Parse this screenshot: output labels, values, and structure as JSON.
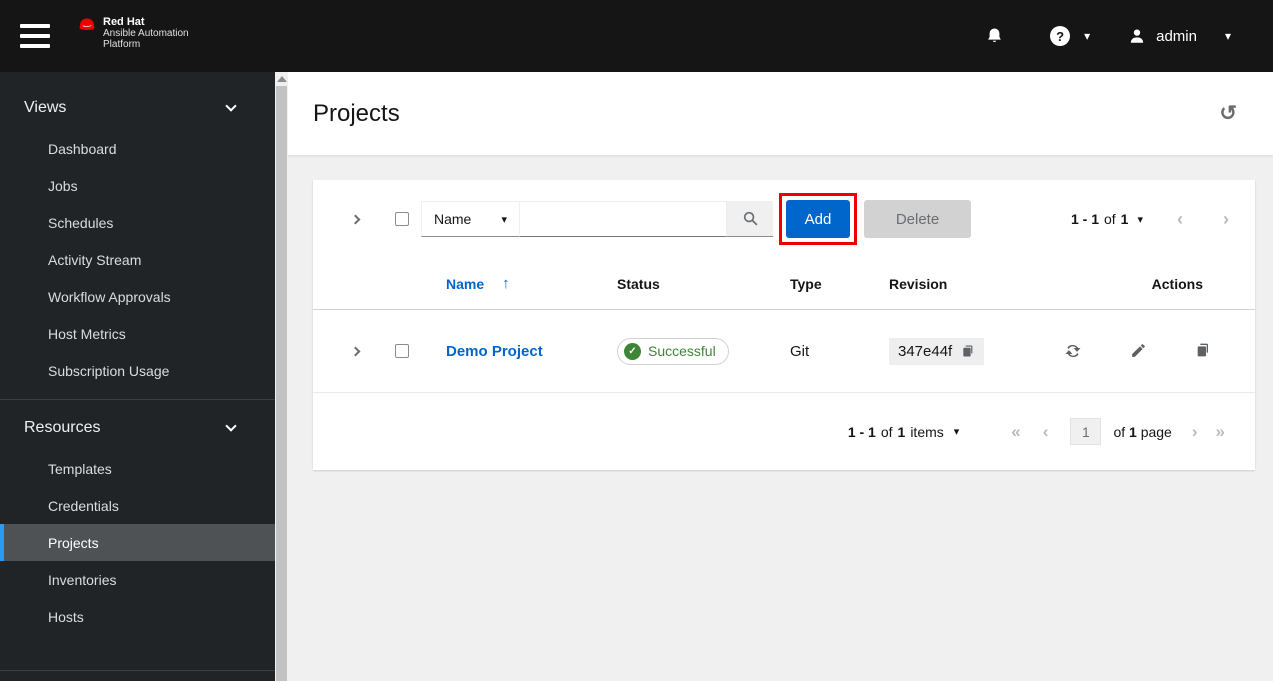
{
  "colors": {
    "primary_blue": "#0066cc",
    "annotation_red": "#ee0000",
    "success_green": "#3e8635",
    "nav_accent_blue": "#2b9af3",
    "masthead_bg": "#151515",
    "sidebar_bg": "#212427"
  },
  "topbar": {
    "brand_line1": "Red Hat",
    "brand_line2": "Ansible Automation",
    "brand_line3": "Platform",
    "user_name": "admin"
  },
  "sidebar": {
    "groups": [
      {
        "label": "Views",
        "items": [
          "Dashboard",
          "Jobs",
          "Schedules",
          "Activity Stream",
          "Workflow Approvals",
          "Host Metrics",
          "Subscription Usage"
        ]
      },
      {
        "label": "Resources",
        "items": [
          "Templates",
          "Credentials",
          "Projects",
          "Inventories",
          "Hosts"
        ],
        "selected": "Projects"
      }
    ]
  },
  "page": {
    "title": "Projects"
  },
  "toolbar": {
    "filter_selected": "Name",
    "search_value": "",
    "add_label": "Add",
    "delete_label": "Delete",
    "pagination_range": "1 - 1",
    "pagination_of": "of",
    "pagination_total": "1"
  },
  "table": {
    "headers": [
      "Name",
      "Status",
      "Type",
      "Revision",
      "Actions"
    ],
    "sort_column": "Name",
    "row": {
      "name": "Demo Project",
      "status_label": "Successful",
      "type": "Git",
      "revision": "347e44f"
    }
  },
  "footer": {
    "items_range": "1 - 1",
    "items_of": "of",
    "items_total": "1",
    "items_label": "items",
    "page_current": "1",
    "page_of": "of",
    "page_total": "1",
    "page_label": "page"
  },
  "icons": {
    "question_mark": "?",
    "caret_down": "▾",
    "sort_ascending": "↑",
    "angle_left": "‹",
    "angle_right": "›",
    "angle_double_left": "«",
    "angle_double_right": "»",
    "check": "✓",
    "history": "↺"
  }
}
